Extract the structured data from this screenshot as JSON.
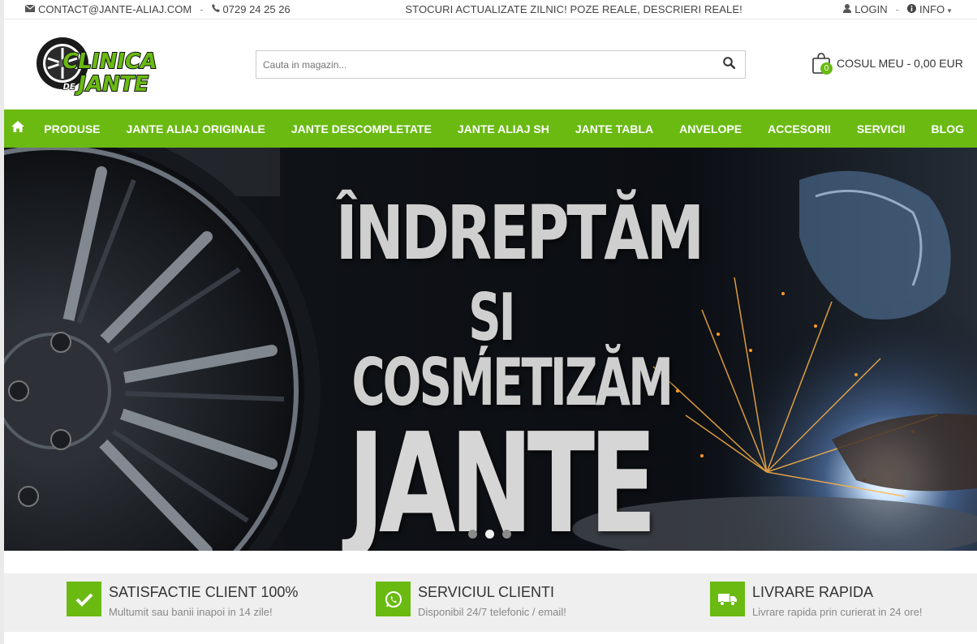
{
  "topbar": {
    "email": "CONTACT@JANTE-ALIAJ.COM",
    "phone": "0729 24 25 26",
    "promo": "STOCURI ACTUALIZATE ZILNIC! POZE REALE, DESCRIERI REALE!",
    "login": "LOGIN",
    "info": "INFO"
  },
  "logo": {
    "line1": "CLINICA",
    "line2": "DE",
    "line3": "JANTE"
  },
  "search": {
    "placeholder": "Cauta in magazin..."
  },
  "cart": {
    "count": "0",
    "label": "COSUL MEU - 0,00 EUR"
  },
  "nav": {
    "items": [
      "PRODUSE",
      "JANTE ALIAJ ORIGINALE",
      "JANTE DESCOMPLETATE",
      "JANTE ALIAJ SH",
      "JANTE TABLA",
      "ANVELOPE",
      "ACCESORII",
      "SERVICII",
      "BLOG"
    ]
  },
  "hero": {
    "line1": "ÎNDREPTĂM",
    "line2": "ȘI COSMETIZĂM",
    "line3": "JANTE",
    "active_slide": 2,
    "slide_count": 3
  },
  "features": [
    {
      "title": "SATISFACTIE CLIENT 100%",
      "subtitle": "Multumit sau banii inapoi in 14 zile!",
      "icon": "check-icon"
    },
    {
      "title": "SERVICIUL CLIENTI",
      "subtitle": "Disponibil 24/7 telefonic / email!",
      "icon": "whatsapp-icon"
    },
    {
      "title": "LIVRARE RAPIDA",
      "subtitle": "Livrare rapida prin curierat in 24 ore!",
      "icon": "truck-icon"
    }
  ],
  "colors": {
    "accent": "#6aba12",
    "topbar_text": "#444444",
    "feature_bg": "#efefef"
  }
}
